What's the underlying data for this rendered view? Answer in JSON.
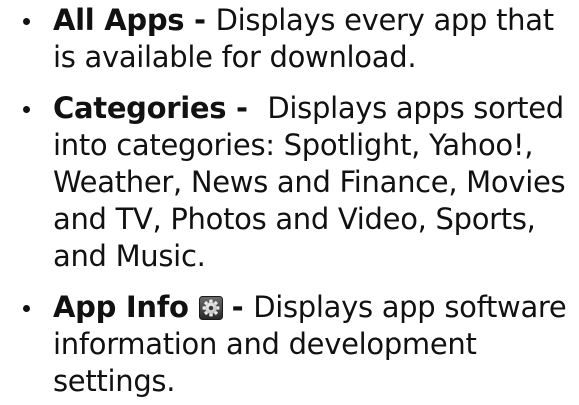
{
  "items": [
    {
      "term": "All Apps",
      "separator": " - ",
      "description": "Displays every app that is available for download."
    },
    {
      "term": "Categories",
      "separator": " -  ",
      "description": "Displays apps sorted into categories: Spotlight, Yahoo!, Weather, News and Finance, Movies and TV, Photos and Video, Sports, and Music."
    },
    {
      "term": "App Info",
      "icon": "gear-icon",
      "separator": "- ",
      "description": "Displays app software information and development settings."
    }
  ]
}
